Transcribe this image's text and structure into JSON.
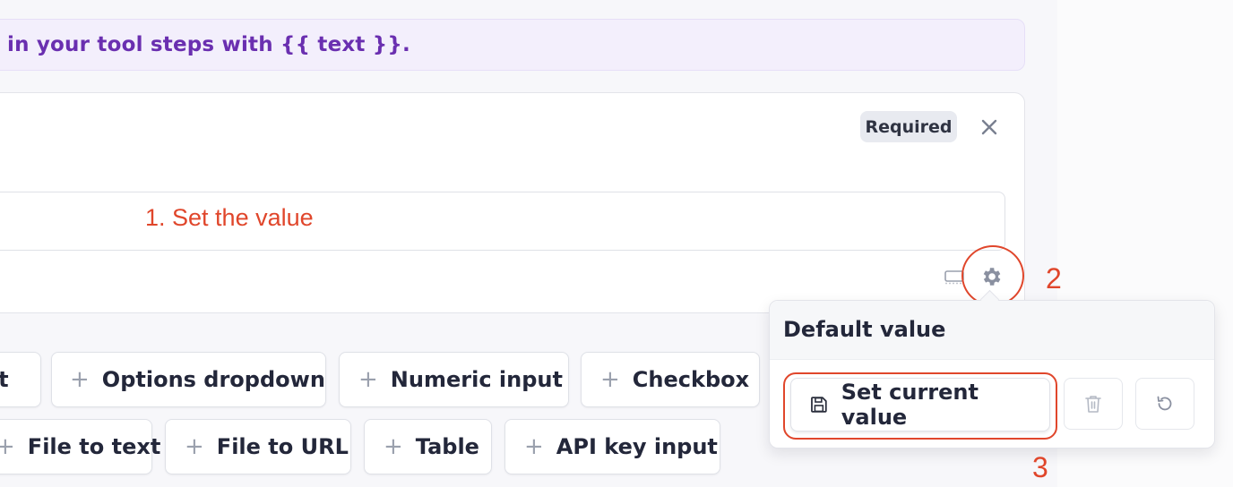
{
  "banner": {
    "text": "in your tool steps with {{ text }}."
  },
  "field": {
    "required_badge": "Required",
    "close_icon": "close-icon"
  },
  "annotations": {
    "step1": "1. Set the value",
    "step2": "2",
    "step3": "3",
    "color": "#e0462b"
  },
  "add_buttons": {
    "row1": [
      "ut",
      "Options dropdown",
      "Numeric input",
      "Checkbox"
    ],
    "row2": [
      "File to text",
      "File to URL",
      "Table",
      "API key input"
    ]
  },
  "default_value_popover": {
    "title": "Default value",
    "set_current_label": "Set current value",
    "icons": [
      "save-icon",
      "trash-icon",
      "reset-icon"
    ]
  },
  "colors": {
    "accent_purple": "#6a2fb0",
    "annotation_red": "#e0462b"
  }
}
